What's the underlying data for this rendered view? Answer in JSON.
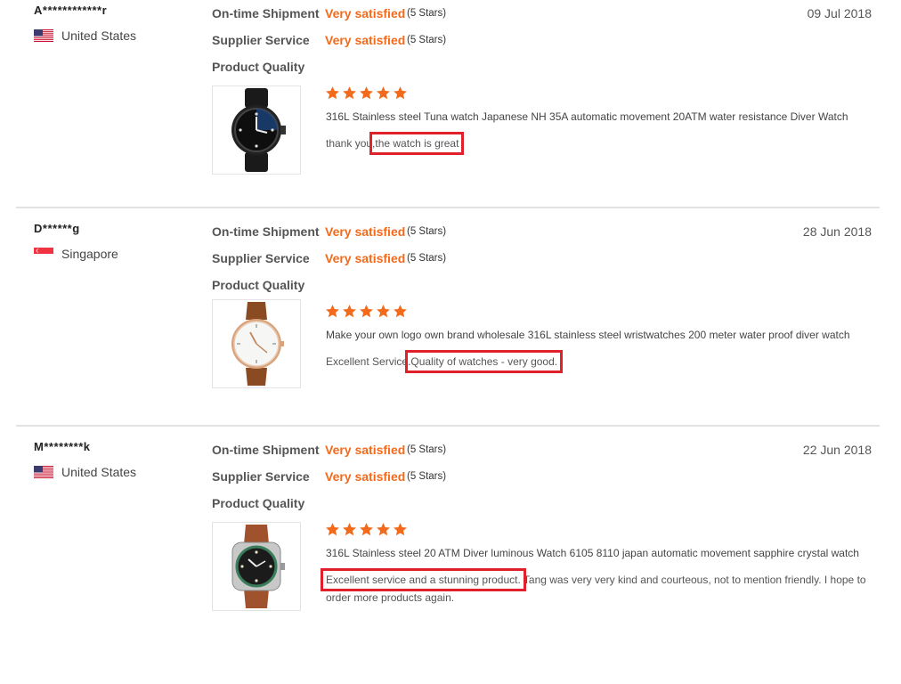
{
  "reviews": [
    {
      "reviewer": "A************r",
      "country": "United States",
      "country_flag": "us-flag-icon",
      "date": "09 Jul 2018",
      "ratings": {
        "shipment_label": "On-time Shipment",
        "shipment_value": "Very satisfied",
        "shipment_stars": "(5 Stars)",
        "service_label": "Supplier Service",
        "service_value": "Very satisfied",
        "service_stars": "(5 Stars)",
        "quality_label": "Product Quality"
      },
      "star_count": 5,
      "product_title": "316L Stainless steel Tuna watch Japanese NH 35A automatic movement 20ATM water resistance Diver Watch",
      "comment_plain": "thank you,",
      "comment_highlight": "the watch is great",
      "comment_rest": ""
    },
    {
      "reviewer": "D******g",
      "country": "Singapore",
      "country_flag": "sg-flag-icon",
      "date": "28 Jun 2018",
      "ratings": {
        "shipment_label": "On-time Shipment",
        "shipment_value": "Very satisfied",
        "shipment_stars": "(5 Stars)",
        "service_label": "Supplier Service",
        "service_value": "Very satisfied",
        "service_stars": "(5 Stars)",
        "quality_label": "Product Quality"
      },
      "star_count": 5,
      "product_title": "Make your own logo own brand wholesale 316L stainless steel wristwatches 200 meter water proof diver watch",
      "comment_plain": "Excellent Service.",
      "comment_highlight": "Quality of watches - very good.",
      "comment_rest": ""
    },
    {
      "reviewer": "M********k",
      "country": "United States",
      "country_flag": "us-flag-icon",
      "date": "22 Jun 2018",
      "ratings": {
        "shipment_label": "On-time Shipment",
        "shipment_value": "Very satisfied",
        "shipment_stars": "(5 Stars)",
        "service_label": "Supplier Service",
        "service_value": "Very satisfied",
        "service_stars": "(5 Stars)",
        "quality_label": "Product Quality"
      },
      "star_count": 5,
      "product_title": "316L Stainless steel 20 ATM Diver luminous Watch 6105 8110 japan automatic movement sapphire crystal watch",
      "comment_plain": "",
      "comment_highlight": "Excellent service and a stunning product.",
      "comment_rest": " Tang was very very kind and courteous, not to mention friendly. I hope to order more products again."
    }
  ],
  "colors": {
    "accent": "#f26a1b",
    "highlight_box": "#e0202a",
    "divider": "#e2e2e2"
  }
}
